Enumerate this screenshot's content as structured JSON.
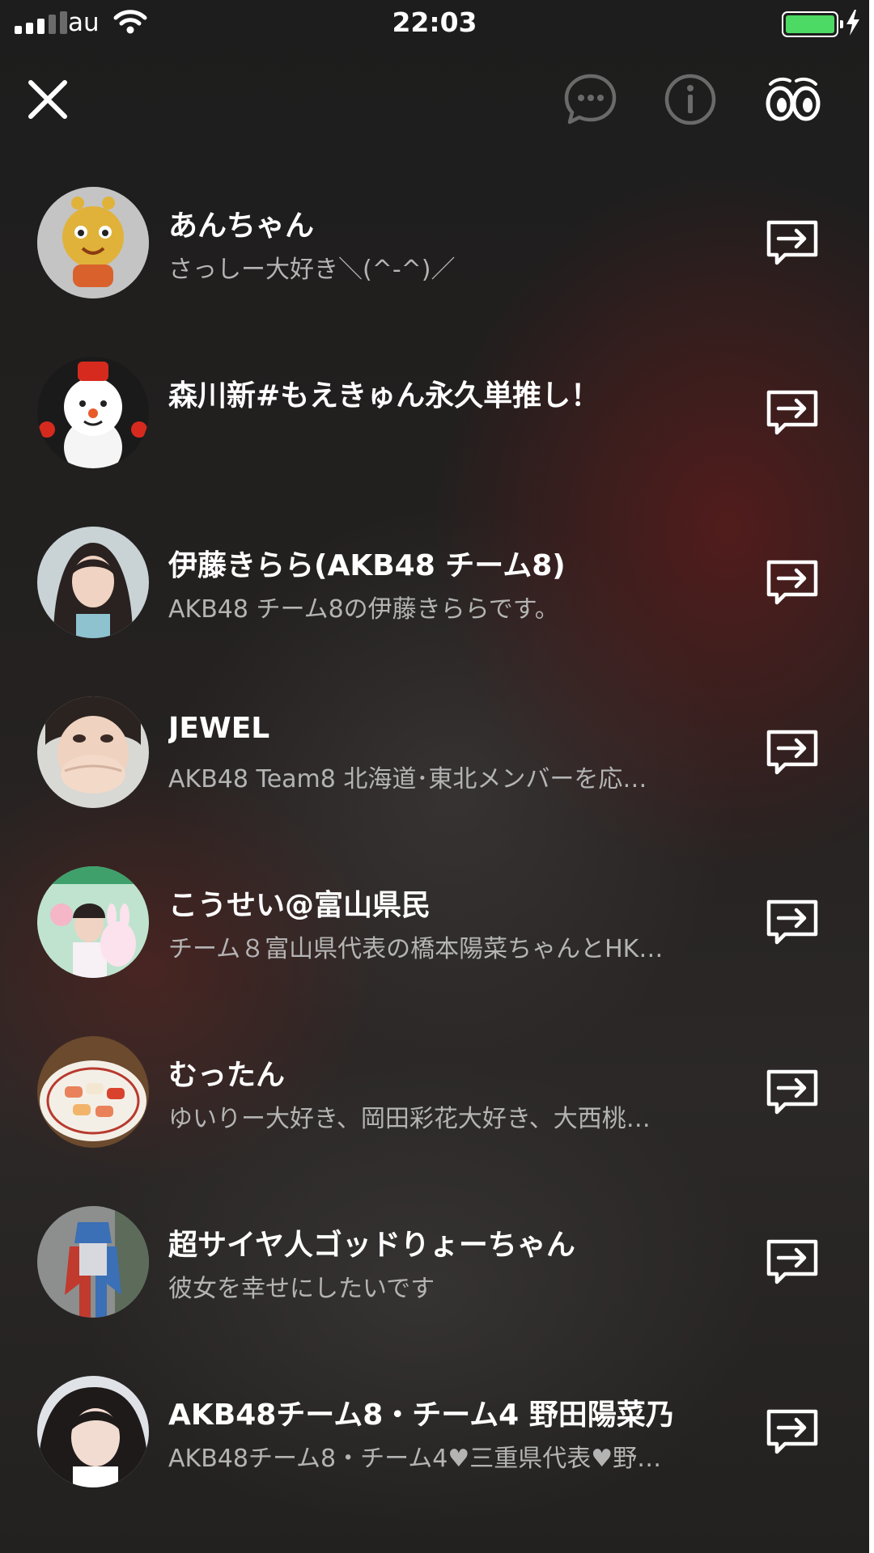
{
  "status_bar": {
    "carrier": "au",
    "time": "22:03",
    "battery_color": "#4cd964"
  },
  "top_bar": {
    "icons": [
      "close-icon",
      "chat-bubble-icon",
      "info-icon",
      "eyes-icon"
    ]
  },
  "users": [
    {
      "name": "あんちゃん",
      "status": "さっしー大好き＼(^-^)／",
      "avatar_icon": "cartoon-mascot-avatar"
    },
    {
      "name": "森川新#もえきゅん永久単推し！",
      "status": "",
      "avatar_icon": "snowman-avatar"
    },
    {
      "name": "伊藤きらら(AKB48 チーム8)",
      "status": "AKB48 チーム8の伊藤きららです。",
      "avatar_icon": "person-photo-avatar"
    },
    {
      "name": "JEWEL",
      "status": "AKB48 Team8 北海道･東北メンバーを応…",
      "avatar_icon": "person-photo-avatar"
    },
    {
      "name": "こうせい@富山県民",
      "status": "チーム８富山県代表の橋本陽菜ちゃんとHK…",
      "avatar_icon": "poster-photo-avatar"
    },
    {
      "name": "むったん",
      "status": "ゆいりー大好き、岡田彩花大好き、大西桃…",
      "avatar_icon": "sushi-photo-avatar"
    },
    {
      "name": "超サイヤ人ゴッドりょーちゃん",
      "status": "彼女を幸せにしたいです",
      "avatar_icon": "figure-photo-avatar"
    },
    {
      "name": "AKB48チーム8・チーム4 野田陽菜乃",
      "status": "AKB48チーム8・チーム4♥三重県代表♥野…",
      "avatar_icon": "person-photo-avatar"
    }
  ]
}
